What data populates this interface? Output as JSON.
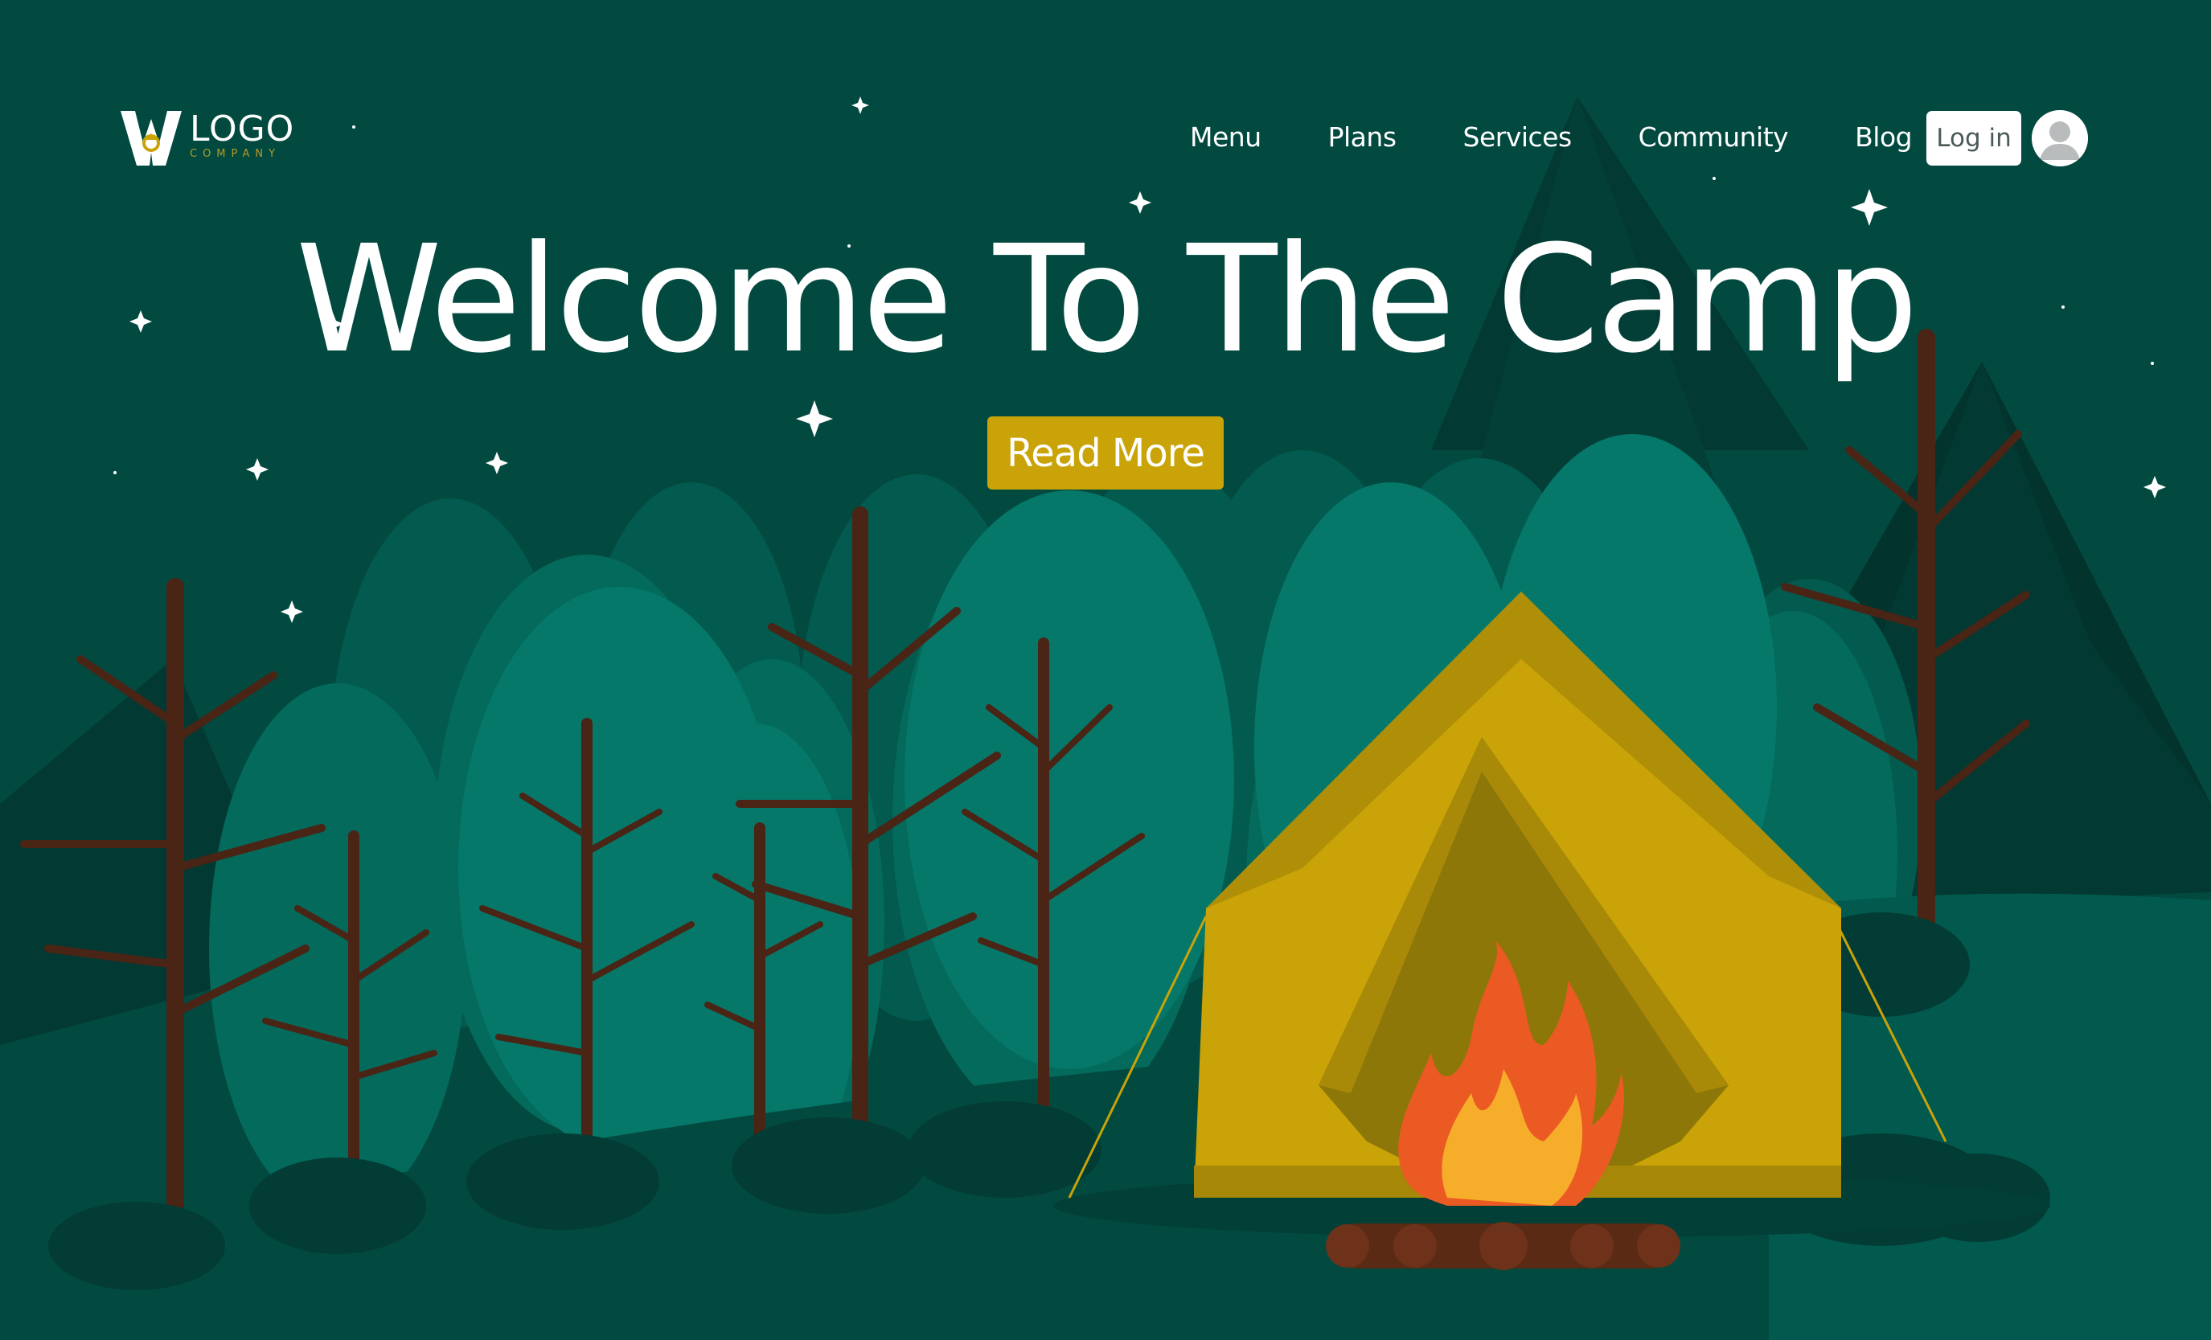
{
  "logo": {
    "mark_letter": "W",
    "word": "LOGO",
    "sub": "COMPANY"
  },
  "nav": {
    "items": [
      {
        "label": "Menu"
      },
      {
        "label": "Plans"
      },
      {
        "label": "Services"
      },
      {
        "label": "Community"
      },
      {
        "label": "Blog"
      }
    ],
    "login_label": "Log in",
    "avatar_icon": "user-avatar-icon"
  },
  "hero": {
    "title": "Welcome To The Camp",
    "cta_label": "Read More"
  },
  "colors": {
    "sky": "#024a40",
    "accent": "#c9a307",
    "tent": "#c9a307",
    "text": "#ffffff"
  }
}
